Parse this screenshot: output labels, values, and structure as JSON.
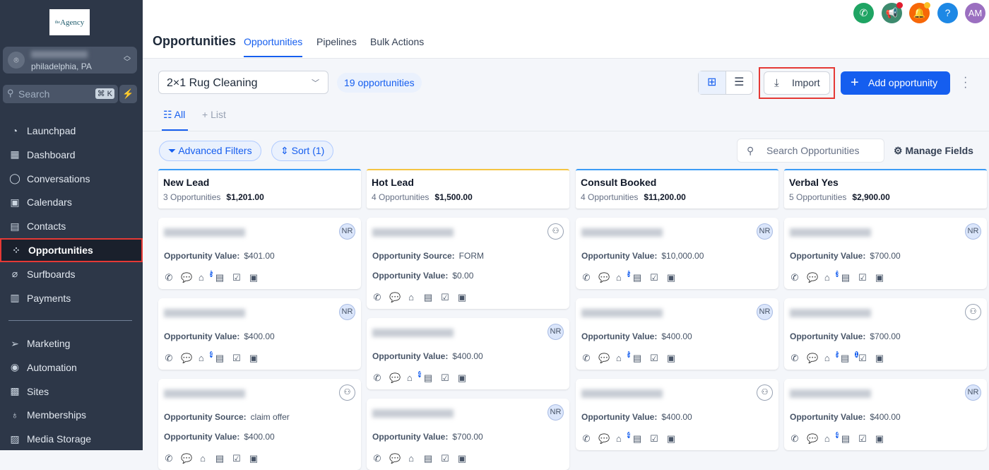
{
  "sidebar": {
    "logo": "theAgency",
    "location_city": "philadelphia, PA",
    "search_placeholder": "Search",
    "search_shortcut": "⌘ K",
    "items": [
      {
        "label": "Launchpad",
        "icon": "◔"
      },
      {
        "label": "Dashboard",
        "icon": "▦"
      },
      {
        "label": "Conversations",
        "icon": "◯"
      },
      {
        "label": "Calendars",
        "icon": "▣"
      },
      {
        "label": "Contacts",
        "icon": "▤"
      },
      {
        "label": "Opportunities",
        "icon": "⁘"
      },
      {
        "label": "Surfboards",
        "icon": "⌀"
      },
      {
        "label": "Payments",
        "icon": "▥"
      }
    ],
    "items2": [
      {
        "label": "Marketing",
        "icon": "➢"
      },
      {
        "label": "Automation",
        "icon": "◉"
      },
      {
        "label": "Sites",
        "icon": "▩"
      },
      {
        "label": "Memberships",
        "icon": "♁"
      },
      {
        "label": "Media Storage",
        "icon": "▨"
      }
    ]
  },
  "header": {
    "title": "Opportunities",
    "tabs": [
      "Opportunities",
      "Pipelines",
      "Bulk Actions"
    ],
    "avatar_initials": "AM"
  },
  "toolbar": {
    "pipeline": "2×1 Rug Cleaning",
    "count": "19 opportunities",
    "import_label": "Import",
    "add_label": "Add opportunity",
    "subtab_all": "All",
    "subtab_list": "List",
    "advanced_filters": "Advanced Filters",
    "sort": "Sort (1)",
    "search_placeholder": "Search Opportunities",
    "manage_fields": "Manage Fields"
  },
  "colors": {
    "accent": "#155eef",
    "sidebar": "#2d3748"
  },
  "columns": [
    {
      "name": "New Lead",
      "count": "3 Opportunities",
      "total": "$1,201.00",
      "color": "#3b9cf6",
      "cards": [
        {
          "assignee": "NR",
          "value": "$401.00",
          "tag_badge": "5"
        },
        {
          "assignee": "NR",
          "value": "$400.00",
          "tag_badge": "4"
        },
        {
          "assignee": "",
          "source": "claim offer",
          "value": "$400.00"
        }
      ]
    },
    {
      "name": "Hot Lead",
      "count": "4 Opportunities",
      "total": "$1,500.00",
      "color": "#f5c542",
      "cards": [
        {
          "assignee": "",
          "source": "FORM",
          "value": "$0.00"
        },
        {
          "assignee": "NR",
          "value": "$400.00",
          "tag_badge": "4"
        },
        {
          "assignee": "NR",
          "value": "$700.00"
        }
      ]
    },
    {
      "name": "Consult Booked",
      "count": "4 Opportunities",
      "total": "$11,200.00",
      "color": "#3b9cf6",
      "cards": [
        {
          "assignee": "NR",
          "value": "$10,000.00",
          "tag_badge": "5"
        },
        {
          "assignee": "NR",
          "value": "$400.00",
          "tag_badge": "5"
        },
        {
          "assignee": "",
          "value": "$400.00",
          "tag_badge": "4"
        }
      ]
    },
    {
      "name": "Verbal Yes",
      "count": "5 Opportunities",
      "total": "$2,900.00",
      "color": "#3b9cf6",
      "cards": [
        {
          "assignee": "NR",
          "value": "$700.00",
          "tag_badge": "3"
        },
        {
          "assignee": "",
          "value": "$700.00",
          "tag_badge": "5",
          "note_badge": "1"
        },
        {
          "assignee": "NR",
          "value": "$400.00",
          "tag_badge": "4"
        }
      ]
    }
  ],
  "labels": {
    "source": "Opportunity Source:",
    "value": "Opportunity Value:"
  }
}
